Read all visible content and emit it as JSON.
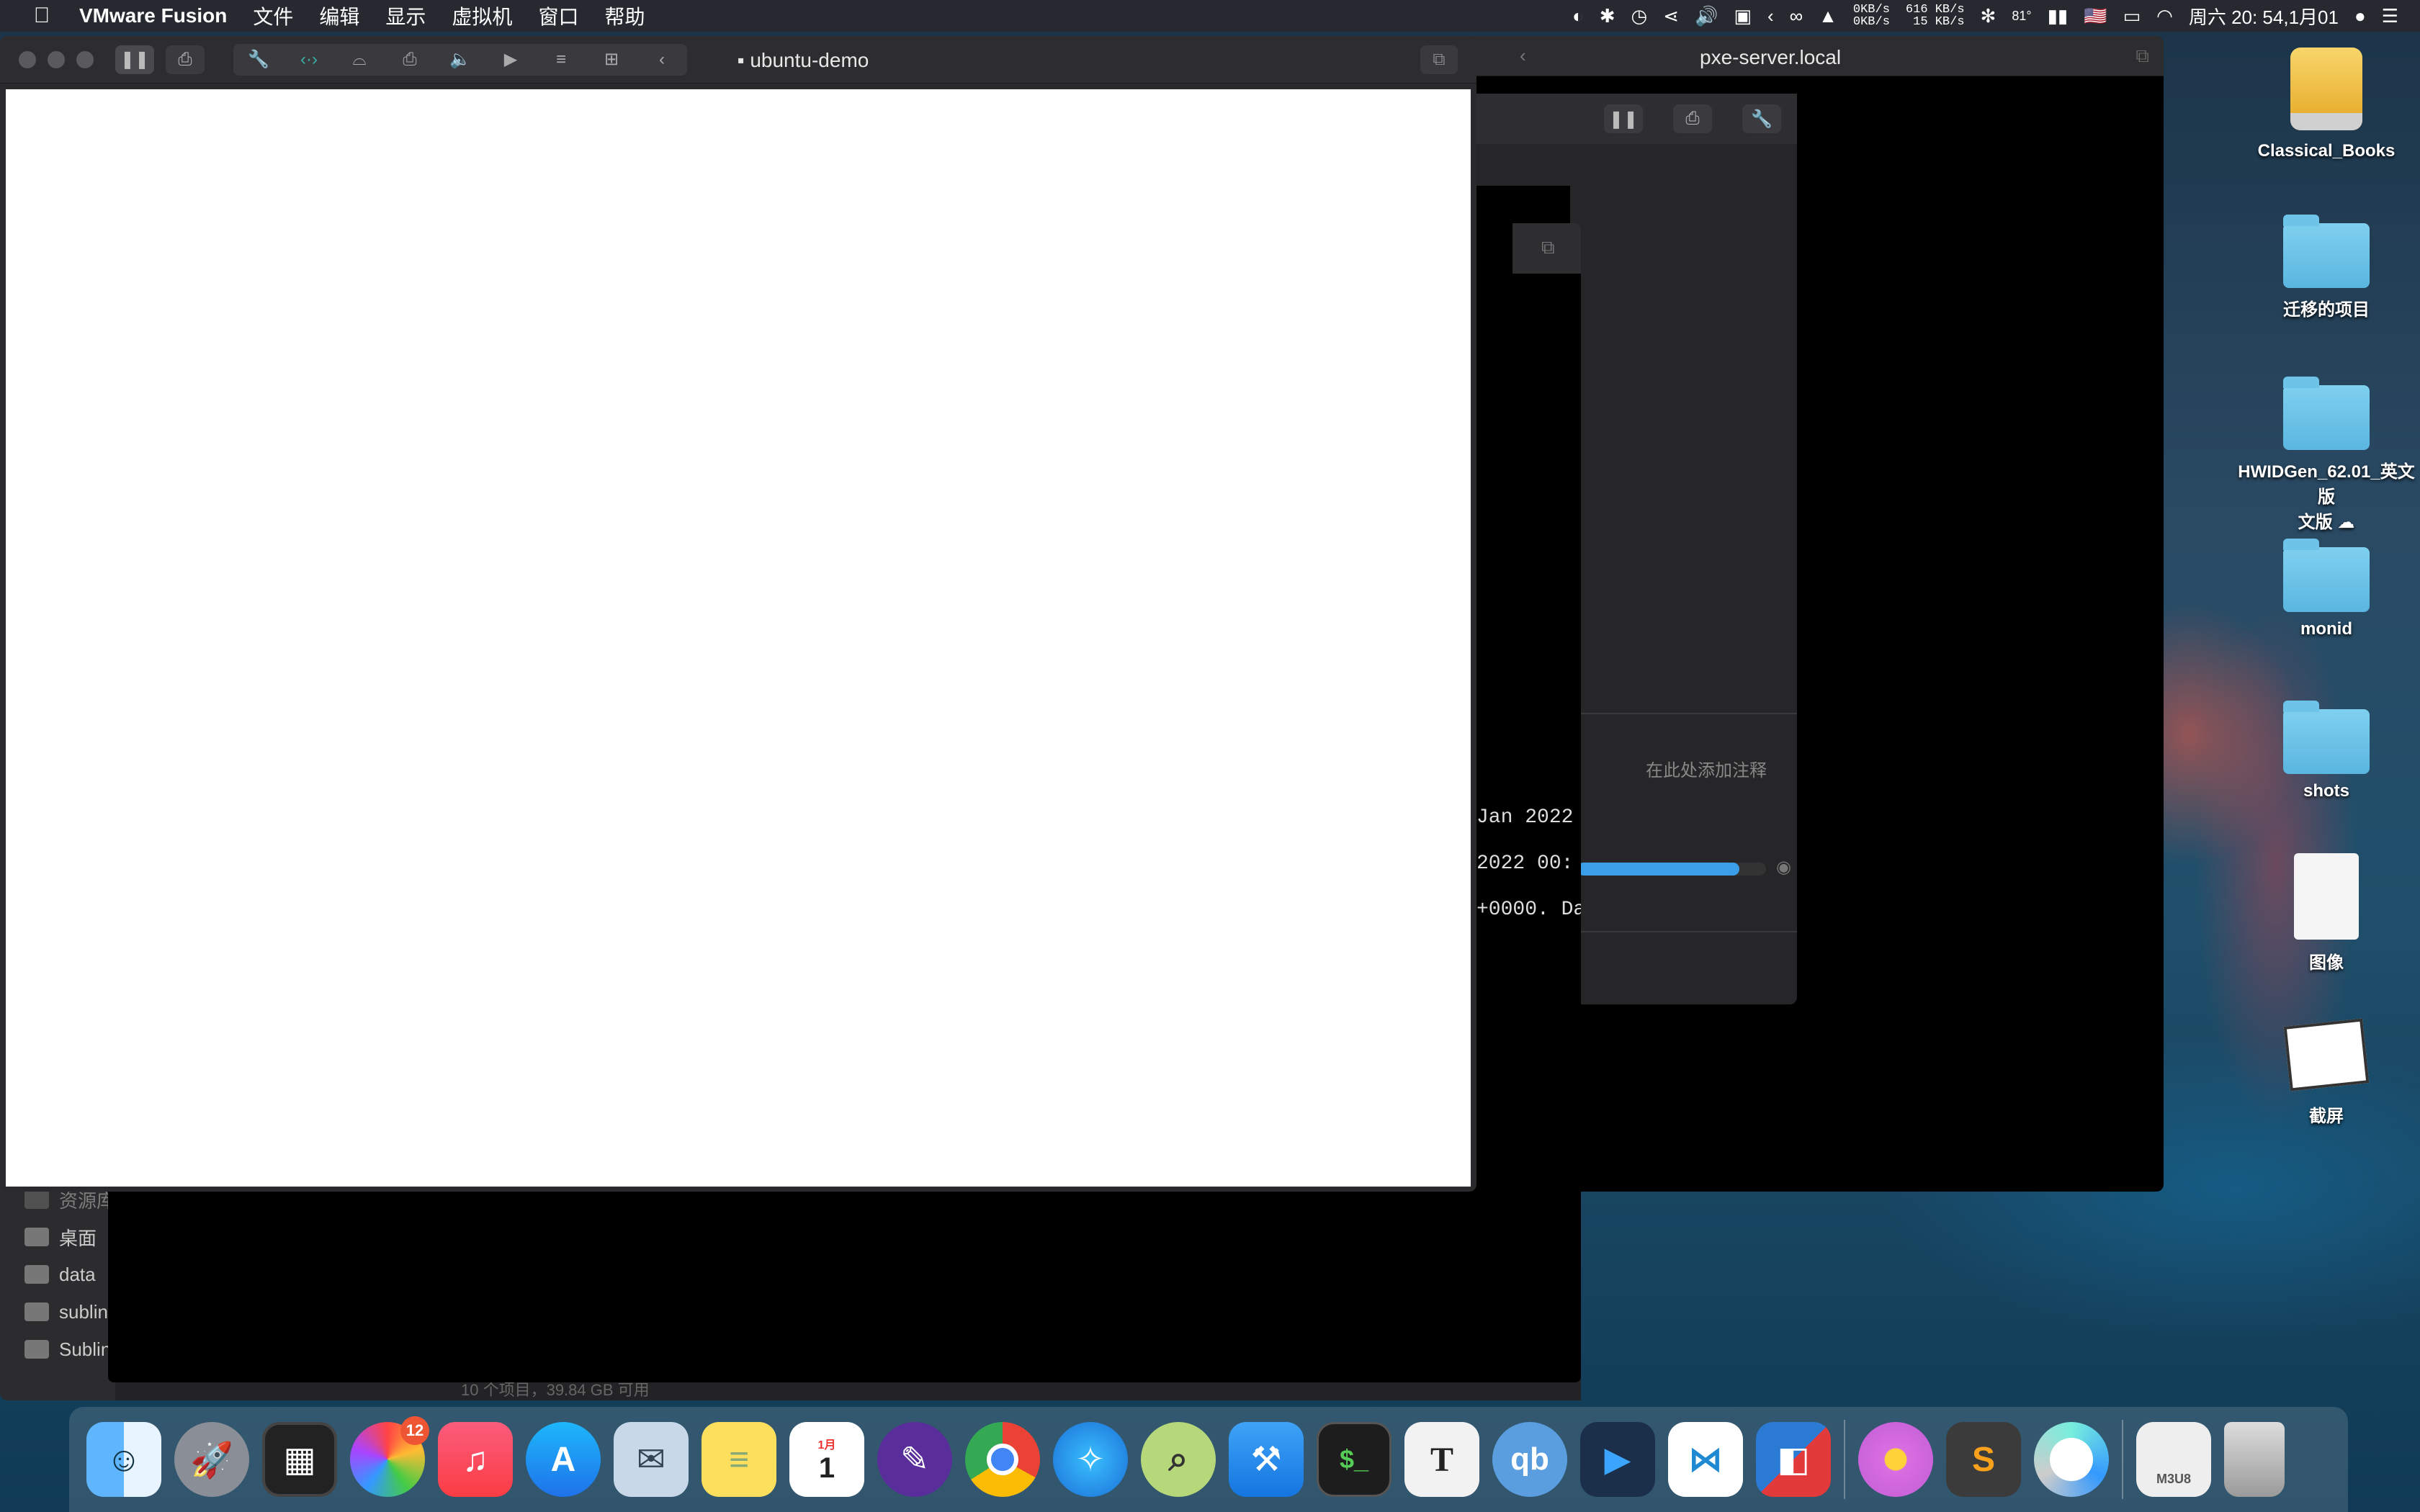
{
  "menubar": {
    "apple": "",
    "app": "VMware Fusion",
    "items": [
      "文件",
      "编辑",
      "显示",
      "虚拟机",
      "窗口",
      "帮助"
    ],
    "net1_up": "0KB/s",
    "net1_down": "0KB/s",
    "net2_up": "616 KB/s",
    "net2_down": "15 KB/s",
    "temp": "81°",
    "flag": "🇺🇸",
    "datetime": "周六 20: 54,1月01"
  },
  "desktop": {
    "items": [
      "Classical_Books",
      "迁移的项目",
      "HWIDGen_62.01_英文版",
      "monid",
      "shots",
      "图像",
      "截屏"
    ],
    "hw_sub": "文版 ☁"
  },
  "pxe": {
    "title": "pxe-server.local"
  },
  "finder": {
    "sidebar": [
      "资源库",
      "桌面",
      "data",
      "sublin",
      "Sublin"
    ],
    "status": "10 个项目，39.84 GB 可用"
  },
  "vminfo": {
    "note_placeholder": "在此处添加注释",
    "line1": "Jan 2022",
    "line2": "2022 00:",
    "line3": "+0000. Da",
    "progress": 0.86
  },
  "ubuntu": {
    "title": "ubuntu-demo"
  },
  "dock": {
    "apps": [
      "Finder",
      "Launchpad",
      "Mission Control",
      "Photos",
      "Music",
      "App Store",
      "Preview",
      "Notes",
      "Calendar",
      "Kite",
      "Chrome",
      "Safari",
      "DB Browser",
      "Xcode",
      "Terminal",
      "Typora",
      "qBittorrent",
      "Infuse",
      "VS Code",
      "VMware Fusion",
      "Petal",
      "Sublime Text",
      "Migration",
      "M3U8",
      "Trash"
    ],
    "photos_badge": "12",
    "cal_month": "1月",
    "cal_day": "1",
    "typora": "T",
    "qb": "qb",
    "m3u8": "M3U8"
  }
}
